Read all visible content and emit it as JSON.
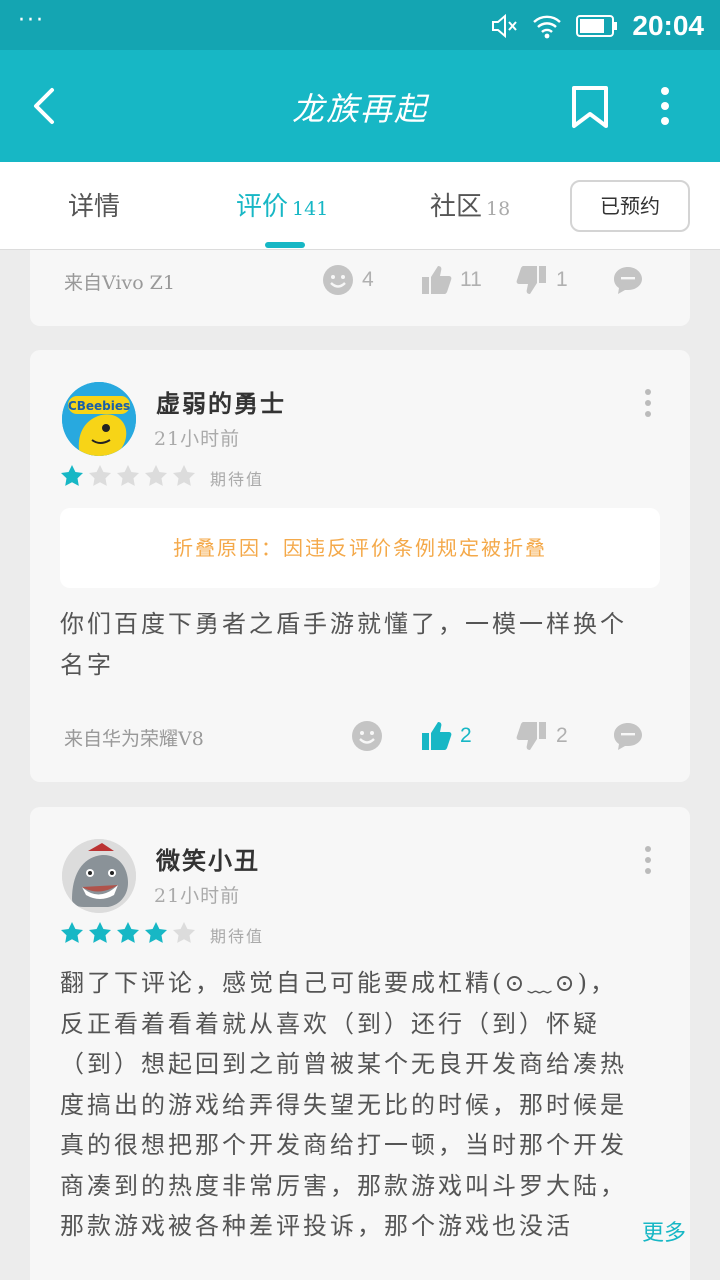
{
  "status_bar": {
    "menu": "···",
    "time": "20:04"
  },
  "app_bar": {
    "title": "龙族再起"
  },
  "tabs": [
    {
      "label": "详情",
      "count": ""
    },
    {
      "label": "评价",
      "count": "141"
    },
    {
      "label": "社区",
      "count": "18"
    }
  ],
  "reserve_button": "已预约",
  "colors": {
    "accent": "#17b7c5",
    "status_bar": "#14a5b2",
    "fold_notice": "#f4a94a"
  },
  "top_card": {
    "source": "来自Vivo Z1",
    "smile_count": "4",
    "like_count": "11",
    "dislike_count": "1"
  },
  "reviews": [
    {
      "username": "虚弱的勇士",
      "time": "21小时前",
      "rating": 1,
      "rating_label": "期待值",
      "fold_notice": "折叠原因：因违反评价条例规定被折叠",
      "text_lines": [
        "你们百度下勇者之盾手游就懂了，一模一样换个",
        "名字"
      ],
      "source": "来自华为荣耀V8",
      "smile_count": "",
      "like_count": "2",
      "dislike_count": "2",
      "liked": true
    },
    {
      "username": "微笑小丑",
      "time": "21小时前",
      "rating": 4,
      "rating_label": "期待值",
      "text_lines": [
        "翻了下评论，感觉自己可能要成杠精(⊙﹏⊙)，",
        "反正看着看着就从喜欢（到）还行（到）怀疑",
        "（到）想起回到之前曾被某个无良开发商给凑热",
        "度搞出的游戏给弄得失望无比的时候，那时候是",
        "真的很想把那个开发商给打一顿，当时那个开发",
        "商凑到的热度非常厉害，那款游戏叫斗罗大陆，",
        "那款游戏被各种差评投诉，那个游戏也没活"
      ],
      "more_label": "更多"
    }
  ]
}
